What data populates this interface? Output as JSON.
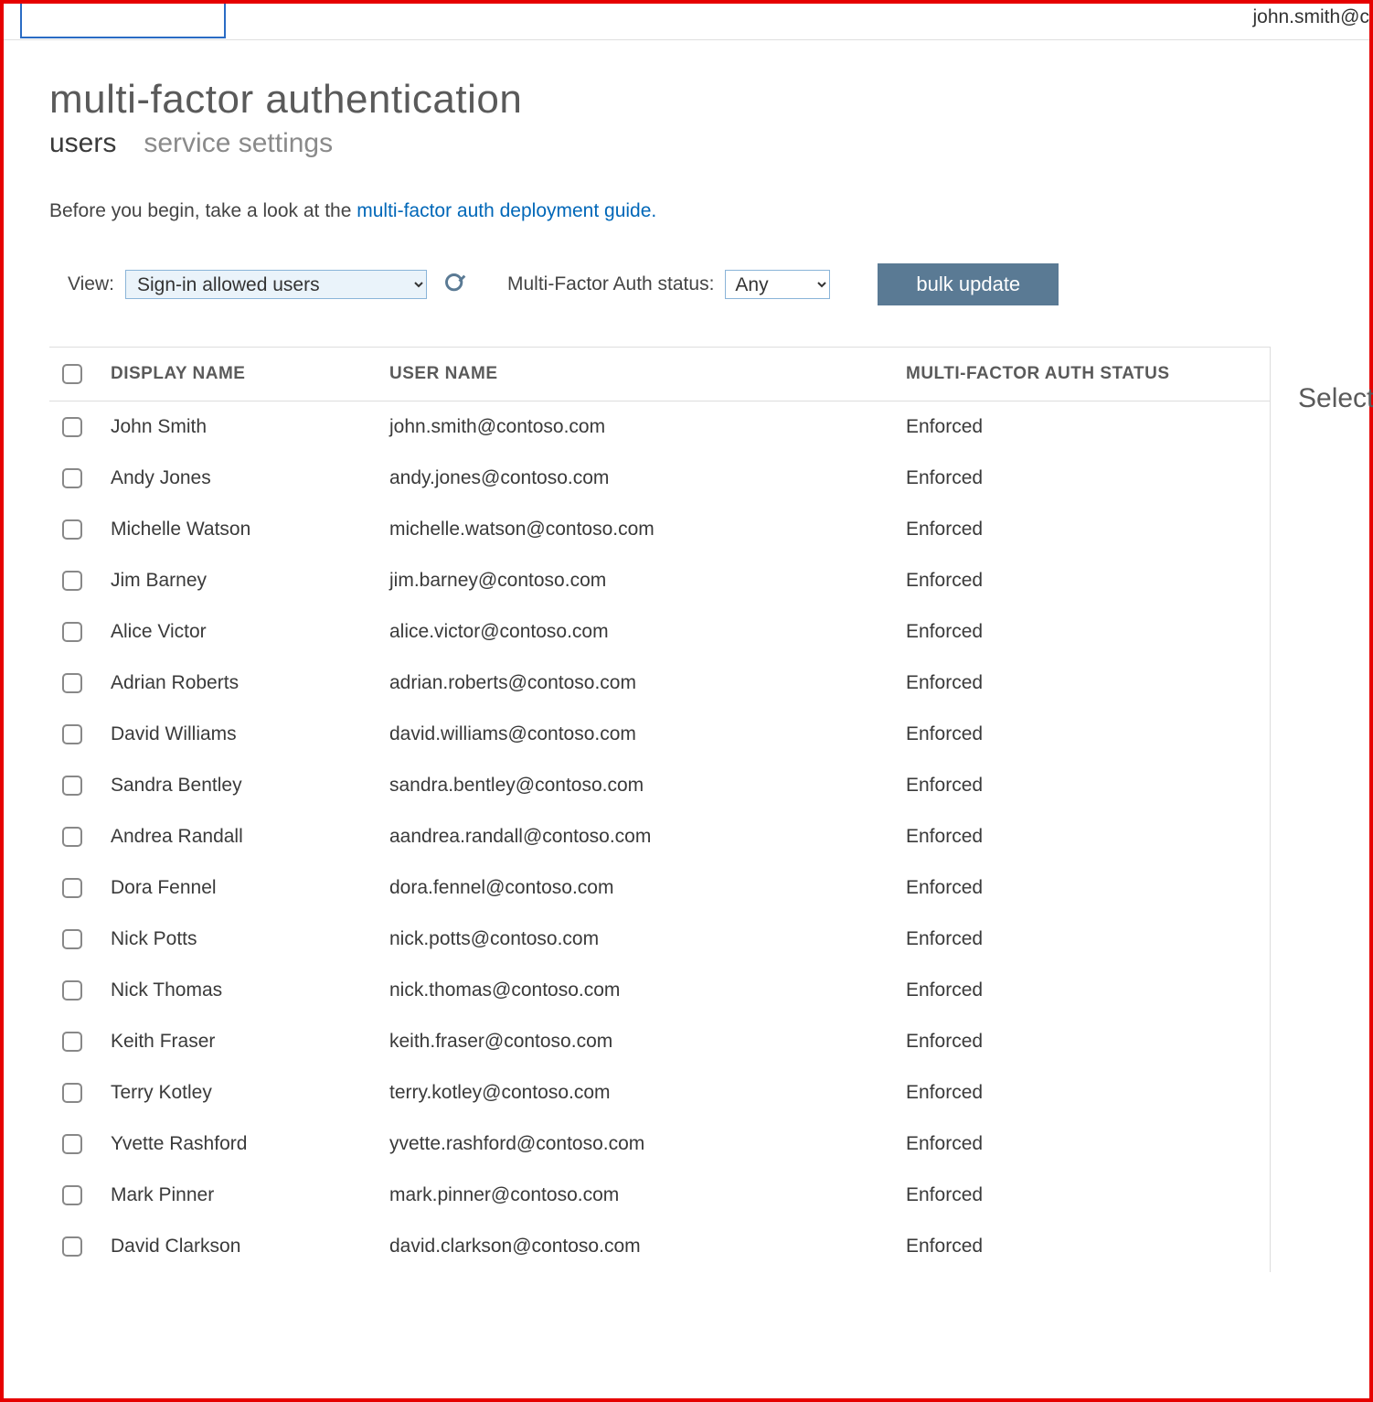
{
  "header": {
    "user_email": "john.smith@c"
  },
  "page": {
    "title": "multi-factor authentication"
  },
  "tabs": {
    "users": "users",
    "service_settings": "service settings"
  },
  "intro": {
    "before_text": "Before you begin, take a look at the ",
    "link_text": "multi-factor auth deployment guide.",
    "after_text": ""
  },
  "filters": {
    "view_label": "View:",
    "view_value": "Sign-in allowed users",
    "status_label": "Multi-Factor Auth status:",
    "status_value": "Any",
    "bulk_update_label": "bulk update"
  },
  "columns": {
    "display_name": "DISPLAY NAME",
    "user_name": "USER NAME",
    "status": "MULTI-FACTOR AUTH STATUS"
  },
  "users": [
    {
      "display": "John Smith",
      "username": "john.smith@contoso.com",
      "status": "Enforced"
    },
    {
      "display": "Andy Jones",
      "username": "andy.jones@contoso.com",
      "status": "Enforced"
    },
    {
      "display": "Michelle Watson",
      "username": "michelle.watson@contoso.com",
      "status": "Enforced"
    },
    {
      "display": "Jim Barney",
      "username": "jim.barney@contoso.com",
      "status": "Enforced"
    },
    {
      "display": "Alice Victor",
      "username": "alice.victor@contoso.com",
      "status": "Enforced"
    },
    {
      "display": "Adrian Roberts",
      "username": "adrian.roberts@contoso.com",
      "status": "Enforced"
    },
    {
      "display": "David Williams",
      "username": "david.williams@contoso.com",
      "status": "Enforced"
    },
    {
      "display": "Sandra Bentley",
      "username": "sandra.bentley@contoso.com",
      "status": "Enforced"
    },
    {
      "display": "Andrea Randall",
      "username": "aandrea.randall@contoso.com",
      "status": "Enforced"
    },
    {
      "display": "Dora Fennel",
      "username": "dora.fennel@contoso.com",
      "status": "Enforced"
    },
    {
      "display": "Nick Potts",
      "username": "nick.potts@contoso.com",
      "status": "Enforced"
    },
    {
      "display": "Nick Thomas",
      "username": "nick.thomas@contoso.com",
      "status": "Enforced"
    },
    {
      "display": "Keith Fraser",
      "username": "keith.fraser@contoso.com",
      "status": "Enforced"
    },
    {
      "display": "Terry Kotley",
      "username": "terry.kotley@contoso.com",
      "status": "Enforced"
    },
    {
      "display": "Yvette Rashford",
      "username": "yvette.rashford@contoso.com",
      "status": "Enforced"
    },
    {
      "display": "Mark Pinner",
      "username": "mark.pinner@contoso.com",
      "status": "Enforced"
    },
    {
      "display": "David Clarkson",
      "username": "david.clarkson@contoso.com",
      "status": "Enforced"
    }
  ],
  "side": {
    "text": "Select"
  }
}
